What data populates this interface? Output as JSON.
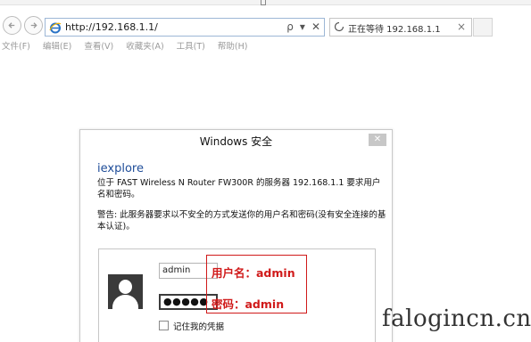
{
  "browser": {
    "url": "http://192.168.1.1/",
    "address_tools": {
      "search": "ρ",
      "dropdown": "▾",
      "stop": "✕"
    },
    "tab": {
      "title": "正在等待 192.168.1.1",
      "close": "×"
    },
    "menu": [
      "文件(F)",
      "编辑(E)",
      "查看(V)",
      "收藏夹(A)",
      "工具(T)",
      "帮助(H)"
    ]
  },
  "dialog": {
    "title": "Windows 安全",
    "close": "✕",
    "app": "iexplore",
    "description": "位于 FAST Wireless N Router FW300R 的服务器 192.168.1.1 要求用户名和密码。",
    "warning": "警告: 此服务器要求以不安全的方式发送你的用户名和密码(没有安全连接的基本认证)。",
    "username_value": "admin",
    "password_masked": "●●●●●",
    "remember_label": "记住我的凭据"
  },
  "annotation": {
    "user_line": "用户名：admin",
    "pass_line": "密码：admin",
    "color": "#d01a1a"
  },
  "watermark": "falogincn.cn"
}
